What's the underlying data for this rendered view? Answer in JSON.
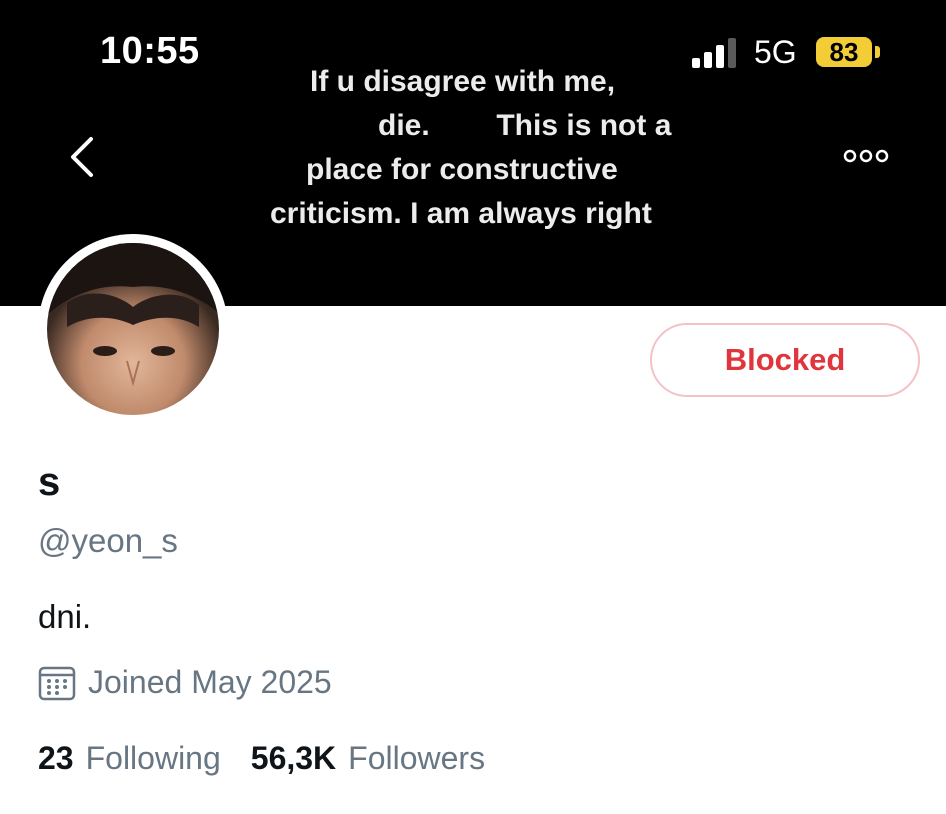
{
  "status_bar": {
    "time": "10:55",
    "network": "5G",
    "battery": "83",
    "battery_color": "#f2cd36"
  },
  "header": {
    "banner_lines": [
      "If u disagree with me,",
      "die.        This is not a",
      "place for constructive",
      "criticism. I am always right"
    ],
    "back_icon": "chevron-left-icon",
    "more_icon": "more-horizontal-icon"
  },
  "profile": {
    "display_name": "s",
    "handle": "@yeon_s",
    "bio": "dni.",
    "joined": "Joined May 2025",
    "joined_icon": "calendar-icon",
    "blocked_label": "Blocked",
    "blocked_color": "#e0353d"
  },
  "stats": {
    "following_count": "23",
    "following_label": "Following",
    "followers_count": "56,3K",
    "followers_label": "Followers"
  }
}
